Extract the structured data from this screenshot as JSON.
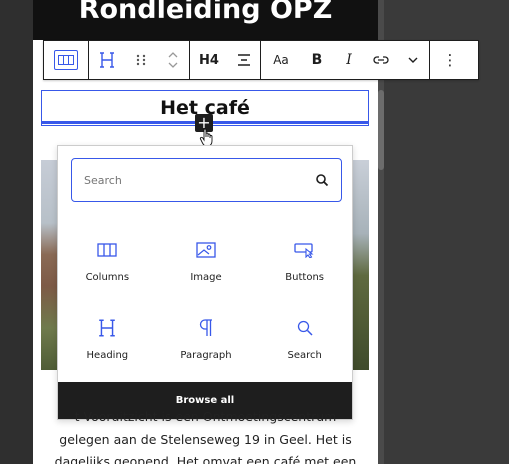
{
  "hero": {
    "title": "Rondleiding OPZ"
  },
  "toolbar": {
    "heading_level": "H4",
    "text_size": "Aa",
    "bold": "B",
    "italic": "I",
    "more": "⋮"
  },
  "heading": {
    "text": "Het café"
  },
  "inserter": {
    "search_placeholder": "Search",
    "blocks": [
      {
        "label": "Columns",
        "icon": "columns-icon"
      },
      {
        "label": "Image",
        "icon": "image-icon"
      },
      {
        "label": "Buttons",
        "icon": "buttons-icon"
      },
      {
        "label": "Heading",
        "icon": "heading-icon"
      },
      {
        "label": "Paragraph",
        "icon": "paragraph-icon"
      },
      {
        "label": "Search",
        "icon": "search-icon"
      }
    ],
    "browse_all": "Browse all"
  },
  "paragraph": {
    "line1": "t Vooruitzicht is een Ontmoetingscentrum",
    "line2": "gelegen aan de Stelenseweg 19 in Geel. Het is",
    "line3": "dagelijks geopend. Het omvat een café met een"
  },
  "colors": {
    "accent": "#3858e9",
    "dark": "#1e1e1e"
  }
}
